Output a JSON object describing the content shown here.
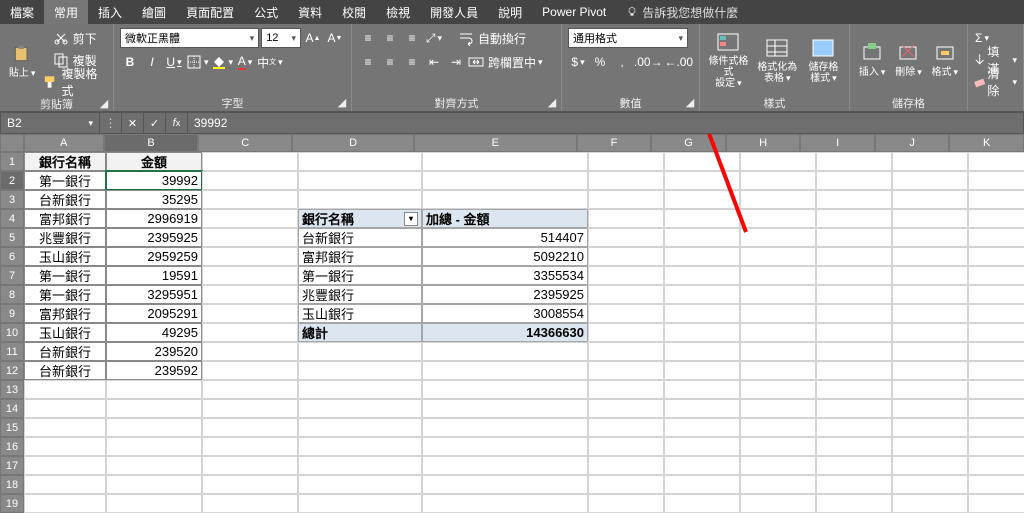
{
  "tabs": {
    "file": "檔案",
    "home": "常用",
    "insert": "插入",
    "draw": "繪圖",
    "layout": "頁面配置",
    "formulas": "公式",
    "data": "資料",
    "review": "校閱",
    "view": "檢視",
    "developer": "開發人員",
    "help": "說明",
    "powerpivot": "Power Pivot",
    "tellme": "告訴我您想做什麼"
  },
  "ribbon": {
    "clipboard": {
      "title": "剪貼簿",
      "paste": "貼上",
      "cut": "剪下",
      "copy": "複製",
      "format_painter": "複製格式"
    },
    "font": {
      "title": "字型",
      "name": "微軟正黑體",
      "size": "12"
    },
    "alignment": {
      "title": "對齊方式",
      "wrap": "自動換行",
      "merge": "跨欄置中"
    },
    "number": {
      "title": "數值",
      "format": "通用格式"
    },
    "styles": {
      "title": "樣式",
      "cond": "條件式格式\n設定",
      "table": "格式化為\n表格",
      "cell": "儲存格\n樣式"
    },
    "cells": {
      "title": "儲存格",
      "insert": "插入",
      "delete": "刪除",
      "format": "格式"
    },
    "editing": {
      "fill": "填滿",
      "clear": "清除"
    }
  },
  "namebox": "B2",
  "formula": "39992",
  "columns": [
    "A",
    "B",
    "C",
    "D",
    "E",
    "F",
    "G",
    "H",
    "I",
    "J",
    "K"
  ],
  "rows": [
    1,
    2,
    3,
    4,
    5,
    6,
    7,
    8,
    9,
    10,
    11,
    12,
    13,
    14,
    15,
    16,
    17,
    18,
    19
  ],
  "sheet": {
    "headers": {
      "bank": "銀行名稱",
      "amount": "金額"
    },
    "data": [
      {
        "bank": "第一銀行",
        "amount": "39992"
      },
      {
        "bank": "台新銀行",
        "amount": "35295"
      },
      {
        "bank": "富邦銀行",
        "amount": "2996919"
      },
      {
        "bank": "兆豐銀行",
        "amount": "2395925"
      },
      {
        "bank": "玉山銀行",
        "amount": "2959259"
      },
      {
        "bank": "第一銀行",
        "amount": "19591"
      },
      {
        "bank": "第一銀行",
        "amount": "3295951"
      },
      {
        "bank": "富邦銀行",
        "amount": "2095291"
      },
      {
        "bank": "玉山銀行",
        "amount": "49295"
      },
      {
        "bank": "台新銀行",
        "amount": "239520"
      },
      {
        "bank": "台新銀行",
        "amount": "239592"
      }
    ]
  },
  "pivot": {
    "hdr_bank": "銀行名稱",
    "hdr_sum": "加總 - 金額",
    "rows": [
      {
        "bank": "台新銀行",
        "v": "514407"
      },
      {
        "bank": "富邦銀行",
        "v": "5092210"
      },
      {
        "bank": "第一銀行",
        "v": "3355534"
      },
      {
        "bank": "兆豐銀行",
        "v": "2395925"
      },
      {
        "bank": "玉山銀行",
        "v": "3008554"
      }
    ],
    "total_label": "總計",
    "total": "14366630"
  }
}
